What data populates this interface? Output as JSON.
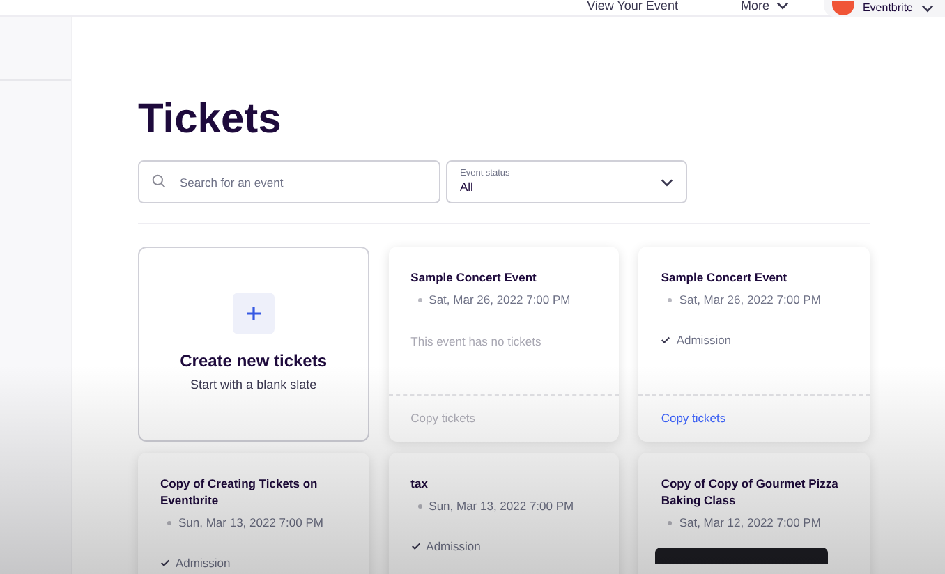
{
  "top_bar": {
    "links": [
      {
        "label": "View Your Event",
        "has_menu": false
      },
      {
        "label": "More",
        "has_menu": true
      }
    ],
    "account": {
      "label": "Eventbrite"
    }
  },
  "title": "Tickets",
  "search": {
    "placeholder": "Search for an event"
  },
  "status_filter": {
    "label": "Event status",
    "value": "All"
  },
  "cards": [
    {
      "kind": "create",
      "title": "Create new tickets",
      "subtitle": "Start with a blank slate"
    },
    {
      "kind": "event",
      "title": "Sample Concert Event",
      "date": "Sat, Mar 26, 2022 7:00 PM",
      "empty_message": "This event has no tickets",
      "copy": {
        "label": "Copy tickets",
        "disabled": true
      }
    },
    {
      "kind": "event",
      "title": "Sample Concert Event",
      "date": "Sat, Mar 26, 2022 7:00 PM",
      "tickets": [
        "Admission"
      ],
      "copy": {
        "label": "Copy tickets",
        "disabled": false
      }
    },
    {
      "kind": "event",
      "title": "Copy of Creating Tickets on Eventbrite",
      "date": "Sun, Mar 13, 2022 7:00 PM",
      "tickets": [
        "Admission"
      ]
    },
    {
      "kind": "event",
      "title": "tax",
      "date": "Sun, Mar 13, 2022 7:00 PM",
      "tickets": [
        "Admission"
      ]
    },
    {
      "kind": "event",
      "title": "Copy of Copy of Gourmet Pizza Baking Class",
      "date": "Sat, Mar 12, 2022 7:00 PM",
      "tooltip": true
    }
  ]
}
